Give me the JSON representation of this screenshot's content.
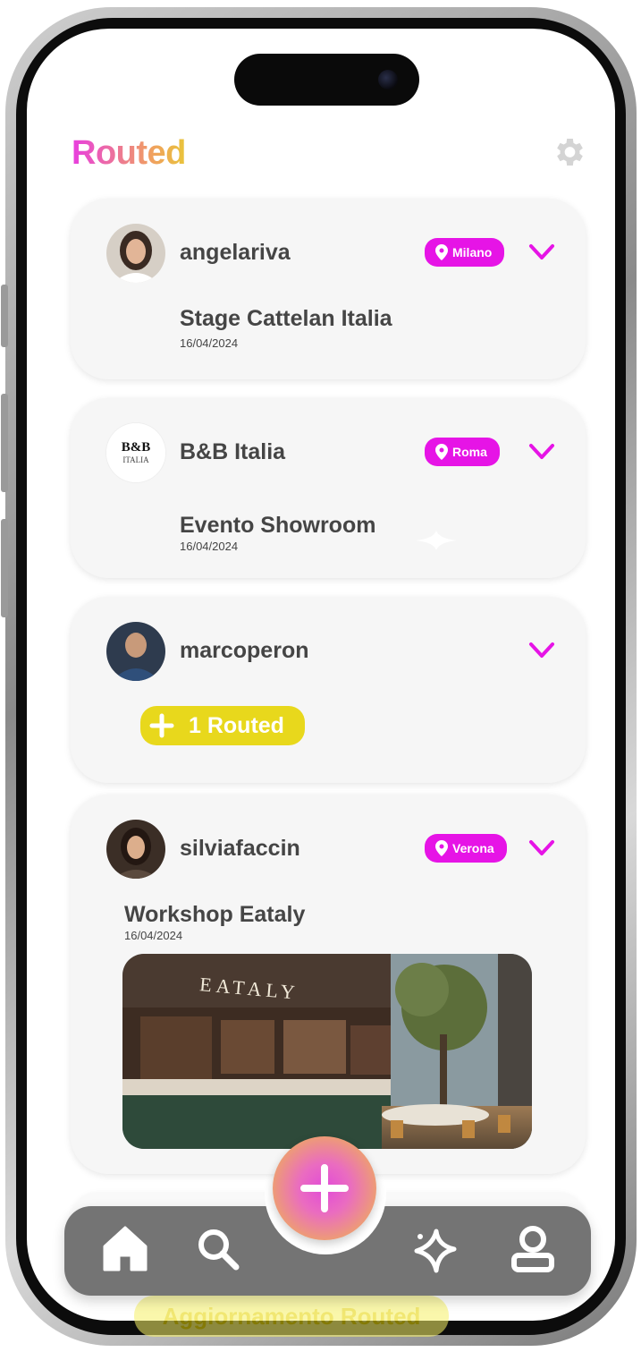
{
  "app": {
    "title": "Routed"
  },
  "colors": {
    "accent": "#e614e6",
    "routed_yellow": "#e8d81c",
    "card_bg": "#f6f6f6",
    "navbar": "#747474",
    "text": "#454545"
  },
  "feed": [
    {
      "username": "angelariva",
      "location": "Milano",
      "post_title": "Stage Cattelan Italia",
      "date": "16/04/2024",
      "avatar_icon": "person-avatar"
    },
    {
      "username": "B&B Italia",
      "location": "Roma",
      "post_title": "Evento Showroom",
      "date": "16/04/2024",
      "avatar_icon": "bb-italia-logo",
      "logo_text": "B&B ITALIA"
    },
    {
      "username": "marcoperon",
      "routed_label": "1 Routed",
      "avatar_icon": "person-avatar"
    },
    {
      "username": "silviafaccin",
      "location": "Verona",
      "post_title": "Workshop Eataly",
      "date": "16/04/2024",
      "avatar_icon": "person-avatar",
      "image_sign": "EATALY"
    }
  ],
  "hidden_pill": {
    "label": "Aggiornamento Routed"
  },
  "navbar": {
    "items": [
      {
        "icon": "home-icon"
      },
      {
        "icon": "search-icon"
      },
      {
        "icon": "add-icon"
      },
      {
        "icon": "sparkle-icon"
      },
      {
        "icon": "profile-icon"
      }
    ]
  }
}
